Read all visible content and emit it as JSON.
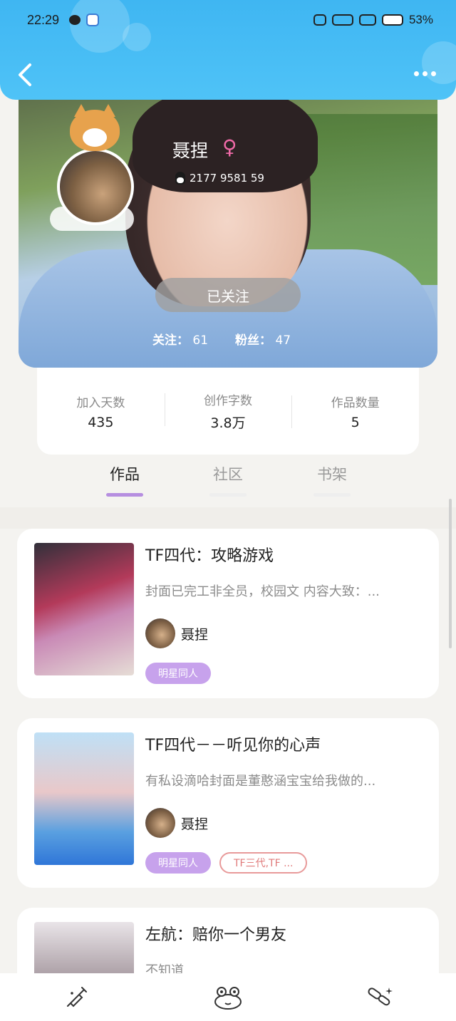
{
  "status_bar": {
    "time": "22:29",
    "battery": "53%"
  },
  "profile": {
    "name": "聂捏",
    "gender_symbol": "♀",
    "qq_number": "2177 9581 59",
    "follow_button": "已关注",
    "following_label": "关注：",
    "following_count": "61",
    "followers_label": "粉丝：",
    "followers_count": "47"
  },
  "stats": [
    {
      "label": "加入天数",
      "value": "435"
    },
    {
      "label": "创作字数",
      "value": "3.8万"
    },
    {
      "label": "作品数量",
      "value": "5"
    }
  ],
  "tabs": [
    {
      "label": "作品",
      "active": true
    },
    {
      "label": "社区",
      "active": false
    },
    {
      "label": "书架",
      "active": false
    }
  ],
  "books": [
    {
      "title": "TF四代：攻略游戏",
      "desc": "封面已完工非全员，校园文 内容大致：...",
      "author": "聂捏",
      "tags": [
        "明星同人"
      ]
    },
    {
      "title": "TF四代－－听见你的心声",
      "desc": "有私设滴哈封面是董憨涵宝宝给我做的...",
      "author": "聂捏",
      "tags": [
        "明星同人",
        "TF三代,TF ..."
      ]
    },
    {
      "title": "左航：赔你一个男友",
      "desc": "不知道",
      "author": "",
      "tags": []
    }
  ],
  "bottom_nav": [
    {
      "icon": "syringe-icon"
    },
    {
      "icon": "frog-icon"
    },
    {
      "icon": "pills-icon"
    }
  ]
}
